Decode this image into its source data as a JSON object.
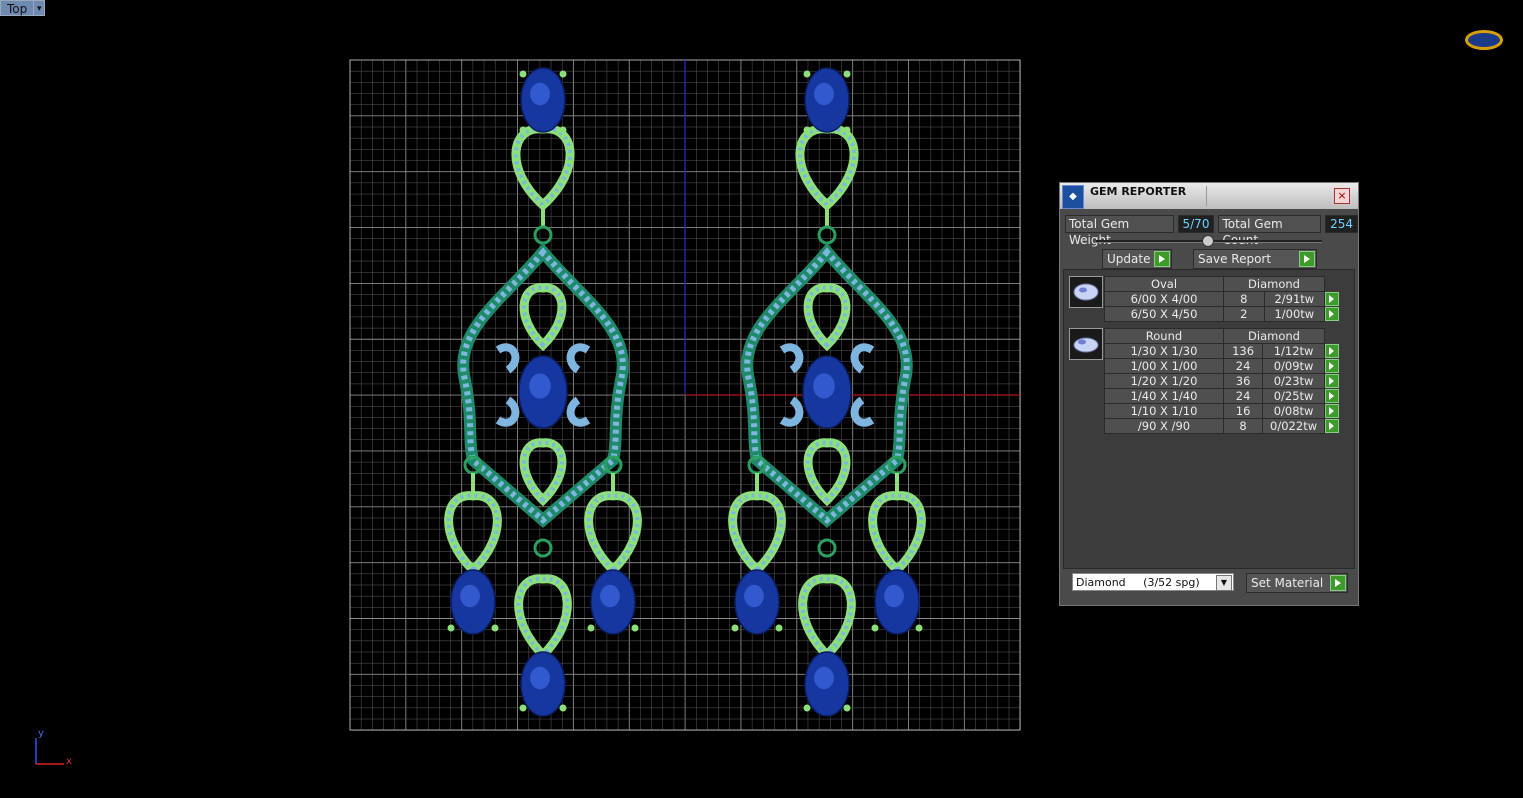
{
  "view": {
    "label": "Top"
  },
  "axes": {
    "y": "y",
    "x": "x"
  },
  "gem_reporter": {
    "title": "GEM REPORTER",
    "total_weight_label": "Total Gem Weight",
    "total_weight_value": "5/70",
    "total_count_label": "Total Gem Count",
    "total_count_value": "254",
    "update_label": "Update",
    "save_label": "Save Report",
    "groups": [
      {
        "shape": "Oval",
        "material": "Diamond",
        "rows": [
          [
            "6/00 X 4/00",
            "8",
            "2/91tw"
          ],
          [
            "6/50 X 4/50",
            "2",
            "1/00tw"
          ]
        ]
      },
      {
        "shape": "Round",
        "material": "Diamond",
        "rows": [
          [
            "1/30 X 1/30",
            "136",
            "1/12tw"
          ],
          [
            "1/00 X 1/00",
            "24",
            "0/09tw"
          ],
          [
            "1/20 X 1/20",
            "36",
            "0/23tw"
          ],
          [
            "1/40 X 1/40",
            "24",
            "0/25tw"
          ],
          [
            "1/10 X 1/10",
            "16",
            "0/08tw"
          ],
          [
            "/90 X /90",
            "8",
            "0/022tw"
          ]
        ]
      }
    ],
    "material_select": "Diamond     (3/52 spg)",
    "set_material_label": "Set Material"
  },
  "colors": {
    "sapphire": "#1637a0",
    "metal": "#8be07a",
    "pave": "#7fb6e0",
    "grid": "#5a5a5a"
  }
}
